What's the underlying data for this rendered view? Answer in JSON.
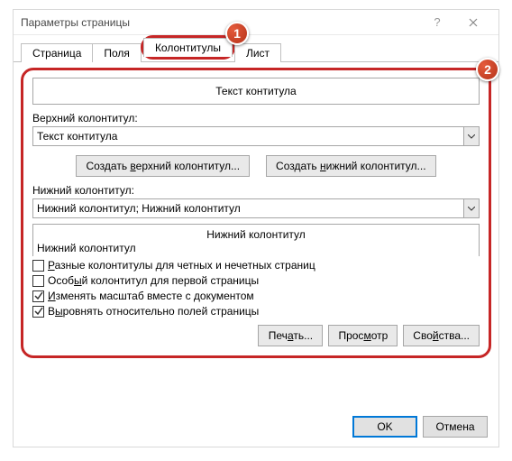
{
  "title": "Параметры страницы",
  "tabs": {
    "page": "Страница",
    "margins": "Поля",
    "headers": "Колонтитулы",
    "sheet": "Лист"
  },
  "previewTop": "Текст контитула",
  "headerLabel": "Верхний колонтитул:",
  "headerValue": "Текст контитула",
  "btnCreateHeader": "Создать верхний колонтитул...",
  "btnCreateFooter": "Создать нижний колонтитул...",
  "footerLabel": "Нижний колонтитул:",
  "footerValue": "Нижний колонтитул; Нижний колонтитул",
  "previewBottomCenter": "Нижний колонтитул",
  "previewBottomLeft": "Нижний колонтитул",
  "cb1": "Разные колонтитулы для четных и нечетных страниц",
  "cb2": "Особый колонтитул для первой страницы",
  "cb3": "Изменять масштаб вместе с документом",
  "cb4": "Выровнять относительно полей страницы",
  "btnPrint": "Печать...",
  "btnPreview": "Просмотр",
  "btnProps": "Свойства...",
  "btnOk": "OK",
  "btnCancel": "Отмена",
  "marker1": "1",
  "marker2": "2"
}
